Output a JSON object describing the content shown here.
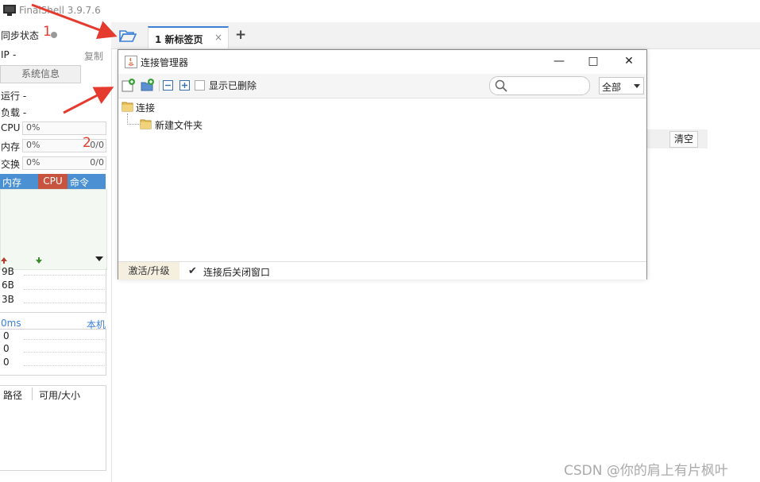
{
  "window": {
    "title": "FinalShell 3.9.7.6"
  },
  "left_panel": {
    "sync_status_label": "同步状态",
    "ip_label": "IP",
    "ip_value": "-",
    "copy_label": "复制",
    "sysinfo_button": "系统信息",
    "running_label": "运行 -",
    "load_label": "负载 -",
    "cpu": {
      "label": "CPU",
      "value": "0%"
    },
    "mem": {
      "label": "内存",
      "value": "0%",
      "extra": "0/0"
    },
    "swap": {
      "label": "交换",
      "value": "0%",
      "extra": "0/0"
    },
    "proc_tabs": [
      "内存",
      "CPU",
      "命令"
    ],
    "net_values": [
      "9B",
      "6B",
      "3B"
    ],
    "ping_label": "0ms",
    "local_label": "本机",
    "ping_values": [
      "0",
      "0",
      "0"
    ],
    "disk_cols": [
      "路径",
      "可用/大小"
    ]
  },
  "tabs": {
    "current_label": "1 新标签页",
    "close_glyph": "×",
    "add_glyph": "+"
  },
  "main": {
    "clear_button": "清空"
  },
  "dialog": {
    "title": "连接管理器",
    "minimize": "—",
    "maximize": "□",
    "close": "✕",
    "show_deleted_label": "显示已删除",
    "filter_value": "全部",
    "tree_root": "连接",
    "tree_child": "新建文件夹",
    "activate_button": "激活/升级",
    "close_after_connect_label": "连接后关闭窗口"
  },
  "annotations": [
    "1",
    "2"
  ],
  "watermark": "CSDN @你的肩上有片枫叶",
  "colors": {
    "accent": "#3b7fd6",
    "cpu_tab": "#c8533e",
    "annotation": "#e53b2f"
  }
}
